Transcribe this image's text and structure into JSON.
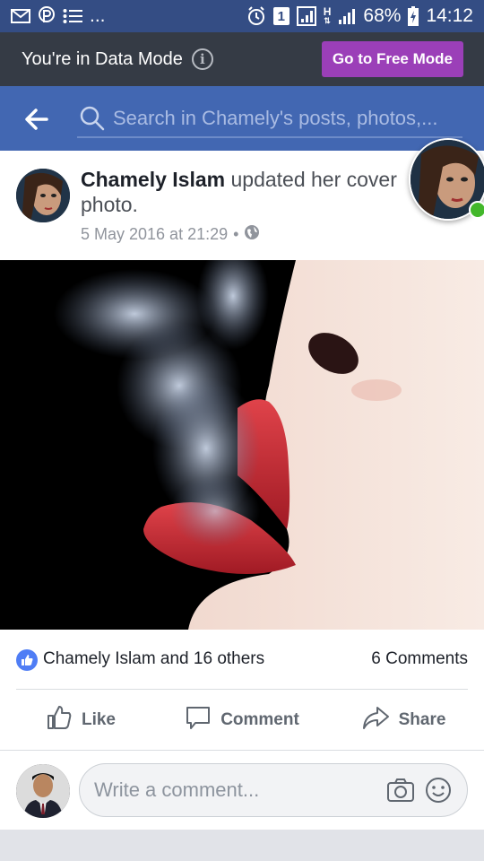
{
  "status_bar": {
    "battery": "68%",
    "time": "14:12",
    "network_letter": "H",
    "sim_number": "1",
    "more": "..."
  },
  "data_mode": {
    "message": "You're in Data Mode",
    "info_glyph": "i",
    "button_label": "Go to Free Mode"
  },
  "search": {
    "placeholder": "Search in Chamely's posts, photos,..."
  },
  "post": {
    "author": "Chamely Islam",
    "action_text": " updated her cover photo.",
    "date": "5 May 2016 at 21:29",
    "separator": "•"
  },
  "reactions": {
    "summary": "Chamely Islam and 16 others",
    "comments": "6 Comments"
  },
  "actions": {
    "like": "Like",
    "comment": "Comment",
    "share": "Share"
  },
  "composer": {
    "placeholder": "Write a comment..."
  },
  "colors": {
    "status_bar": "#344d84",
    "header_blue": "#4267b2",
    "free_mode_purple": "#9b3fb8",
    "like_blue": "#4f7df5",
    "online_green": "#42b72a"
  }
}
